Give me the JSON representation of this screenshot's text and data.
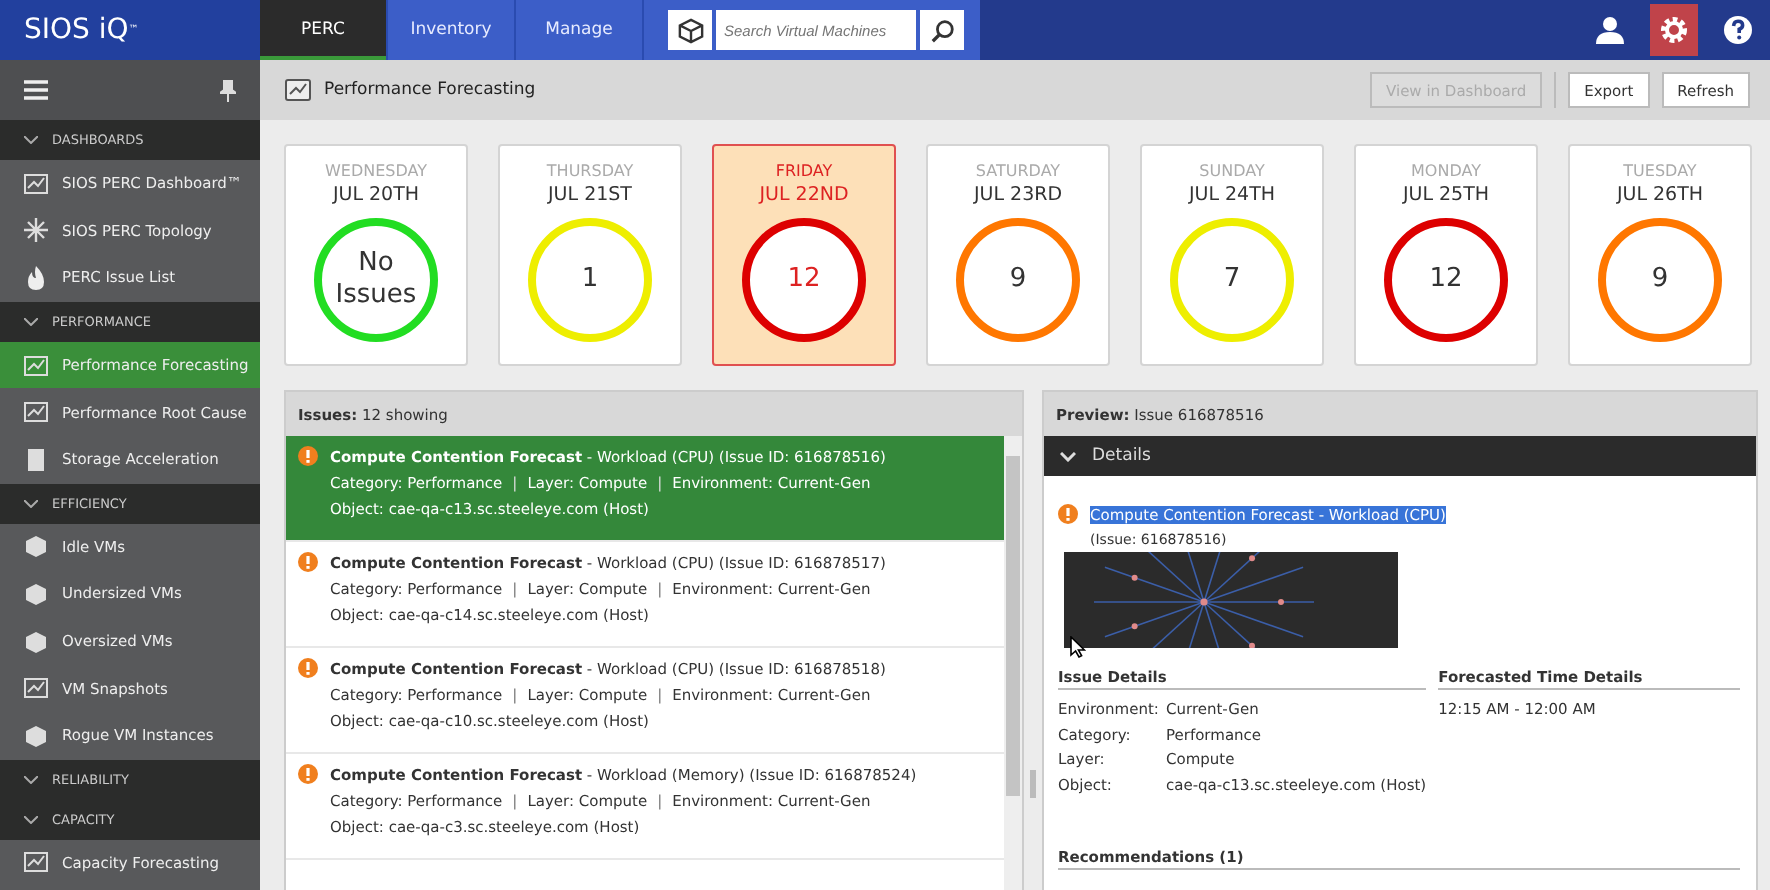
{
  "app": {
    "logo": "SIOS iQ$^{™}$"
  },
  "nav_tabs": [
    {
      "label": "PERC",
      "selected": true
    },
    {
      "label": "Inventory",
      "selected": false
    },
    {
      "label": "Manage",
      "selected": false
    }
  ],
  "search": {
    "placeholder": "Search Virtual Machines"
  },
  "top_icons": [
    {
      "kind": "user",
      "selected": false
    },
    {
      "kind": "settings",
      "selected": true
    },
    {
      "kind": "help",
      "selected": false
    }
  ],
  "sidebar": {
    "items": [
      {
        "kind": "header",
        "label": "DASHBOARDS"
      },
      {
        "kind": "item",
        "label": "SIOS PERC Dashboard™",
        "selected": false
      },
      {
        "kind": "item",
        "label": "SIOS PERC Topology",
        "selected": false
      },
      {
        "kind": "item",
        "label": "PERC Issue List",
        "selected": false
      },
      {
        "kind": "header",
        "label": "PERFORMANCE"
      },
      {
        "kind": "item",
        "label": "Performance Forecasting",
        "selected": true
      },
      {
        "kind": "item",
        "label": "Performance Root Cause",
        "selected": false
      },
      {
        "kind": "item",
        "label": "Storage Acceleration",
        "selected": false
      },
      {
        "kind": "header",
        "label": "EFFICIENCY"
      },
      {
        "kind": "item",
        "label": "Idle VMs",
        "selected": false
      },
      {
        "kind": "item",
        "label": "Undersized VMs",
        "selected": false
      },
      {
        "kind": "item",
        "label": "Oversized VMs",
        "selected": false
      },
      {
        "kind": "item",
        "label": "VM Snapshots",
        "selected": false
      },
      {
        "kind": "item",
        "label": "Rogue VM Instances",
        "selected": false
      },
      {
        "kind": "header",
        "label": "RELIABILITY"
      },
      {
        "kind": "header",
        "label": "CAPACITY"
      },
      {
        "kind": "item",
        "label": "Capacity Forecasting",
        "selected": false
      }
    ]
  },
  "page": {
    "title": "Performance Forecasting",
    "buttons": [
      {
        "label": "View in Dashboard",
        "disabled": true
      },
      {
        "label": "Export",
        "disabled": false
      },
      {
        "label": "Refresh",
        "disabled": false
      }
    ]
  },
  "days": [
    {
      "weekday": "WEDNESDAY",
      "date": "JUL 20TH",
      "count": "No Issues",
      "color": "#22dd22",
      "selected": false
    },
    {
      "weekday": "THURSDAY",
      "date": "JUL 21ST",
      "count": "1",
      "color": "#eeee00",
      "selected": false
    },
    {
      "weekday": "FRIDAY",
      "date": "JUL 22ND",
      "count": "12",
      "color": "#dd0000",
      "selected": true
    },
    {
      "weekday": "SATURDAY",
      "date": "JUL 23RD",
      "count": "9",
      "color": "#ff7700",
      "selected": false
    },
    {
      "weekday": "SUNDAY",
      "date": "JUL 24TH",
      "count": "7",
      "color": "#eeee00",
      "selected": false
    },
    {
      "weekday": "MONDAY",
      "date": "JUL 25TH",
      "count": "12",
      "color": "#dd0000",
      "selected": false
    },
    {
      "weekday": "TUESDAY",
      "date": "JUL 26TH",
      "count": "9",
      "color": "#ff7700",
      "selected": false
    }
  ],
  "issues": {
    "label": "Issues:",
    "count": "12 showing",
    "rows": [
      {
        "title": "Compute Contention Forecast",
        "detail": "- Workload (CPU) (Issue ID: 616878516)",
        "category": "Category: Performance",
        "layer": "Layer: Compute",
        "environment": "Environment: Current-Gen",
        "object": "Object: cae-qa-c13.sc.steeleye.com (Host)",
        "separator": "|",
        "selected": true
      },
      {
        "title": "Compute Contention Forecast",
        "detail": "- Workload (CPU) (Issue ID: 616878517)",
        "category": "Category: Performance",
        "layer": "Layer: Compute",
        "environment": "Environment: Current-Gen",
        "object": "Object: cae-qa-c14.sc.steeleye.com (Host)",
        "separator": "|",
        "selected": false
      },
      {
        "title": "Compute Contention Forecast",
        "detail": "- Workload (CPU) (Issue ID: 616878518)",
        "category": "Category: Performance",
        "layer": "Layer: Compute",
        "environment": "Environment: Current-Gen",
        "object": "Object: cae-qa-c10.sc.steeleye.com (Host)",
        "separator": "|",
        "selected": false
      },
      {
        "title": "Compute Contention Forecast",
        "detail": "- Workload (Memory) (Issue ID: 616878524)",
        "category": "Category: Performance",
        "layer": "Layer: Compute",
        "environment": "Environment: Current-Gen",
        "object": "Object: cae-qa-c3.sc.steeleye.com (Host)",
        "separator": "|",
        "selected": false
      }
    ]
  },
  "preview": {
    "label": "Preview:",
    "issue": "Issue 616878516",
    "section": {
      "label": "Details",
      "expanded": true
    },
    "title": "Compute Contention Forecast - Workload (CPU)",
    "title_selected": true,
    "issue_id": "(Issue: 616878516)",
    "issue_details": {
      "heading": "Issue Details",
      "fields": [
        {
          "label": "Environment:",
          "value": "Current-Gen"
        },
        {
          "label": "Category:",
          "value": "Performance"
        },
        {
          "label": "Layer:",
          "value": "Compute"
        },
        {
          "label": "Object:",
          "value": "cae-qa-c13.sc.steeleye.com (Host)"
        }
      ]
    },
    "time_details": {
      "heading": "Forecasted Time Details",
      "value": "12:15 AM - 12:00 AM"
    },
    "recommendations": {
      "heading": "Recommendations (1)"
    }
  }
}
